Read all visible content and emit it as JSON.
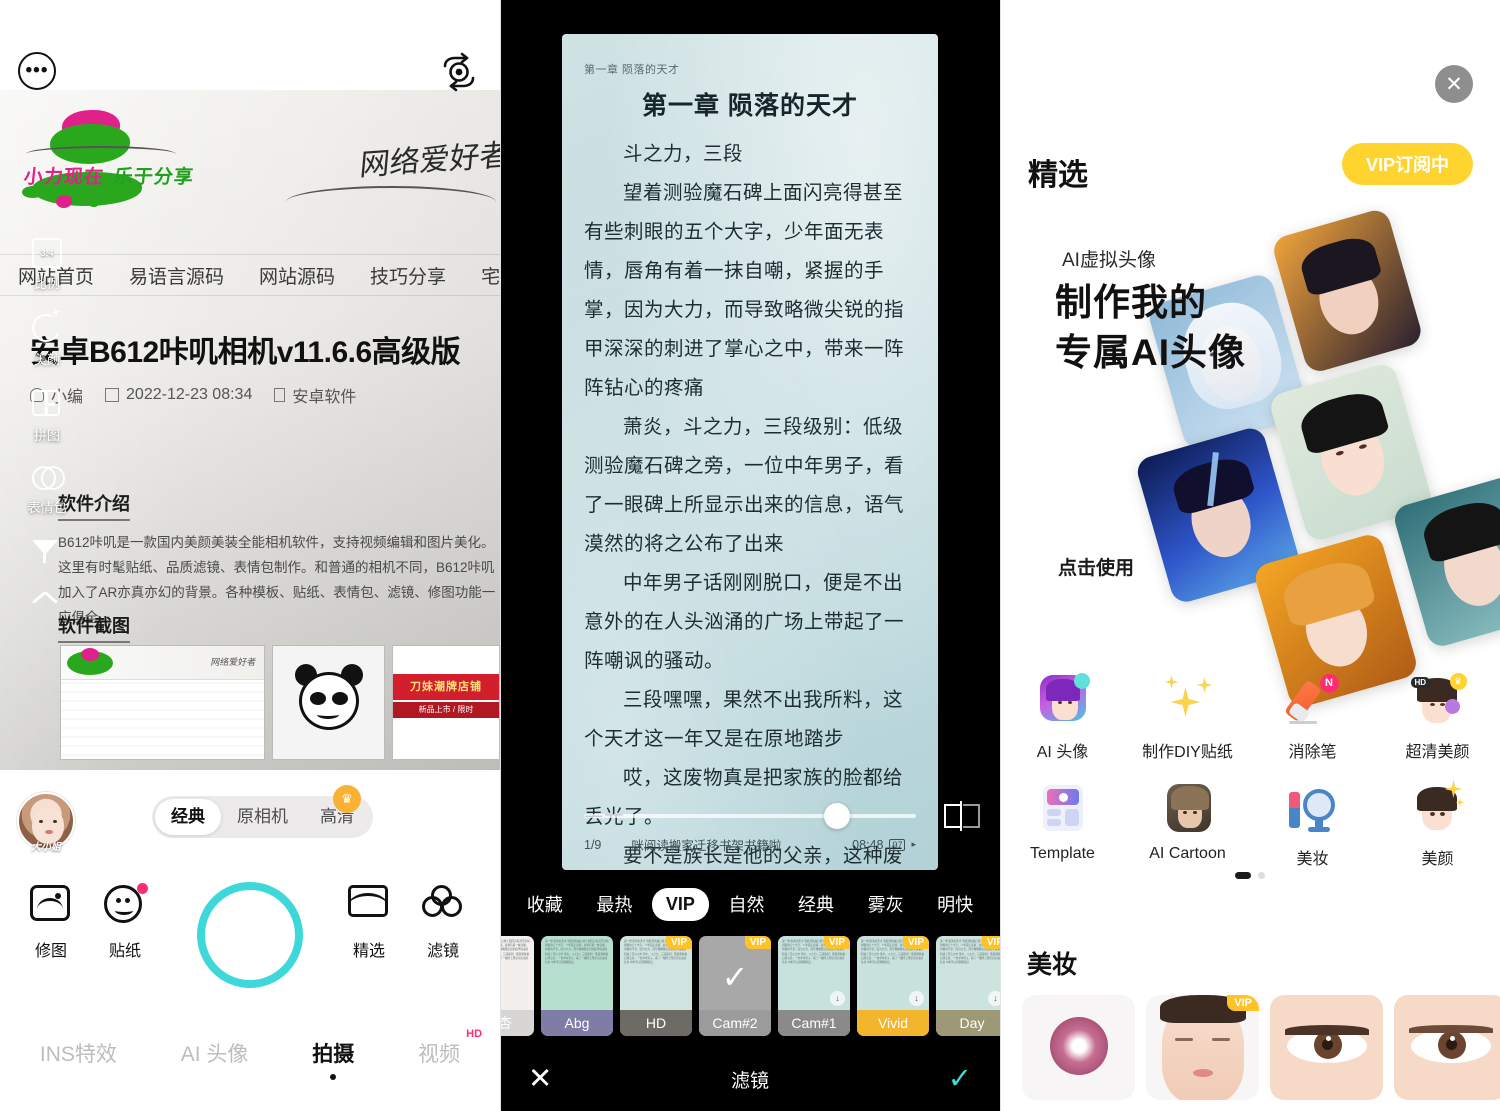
{
  "camera": {
    "topbar": {
      "more_icon": "more-dots-icon",
      "flip_icon": "camera-flip-icon"
    },
    "photo": {
      "logo_text_pink": "小力现在",
      "logo_text_green": "乐于分享",
      "handwriting": "网络爱好者",
      "nav_items": [
        "网站首页",
        "易语言源码",
        "网站源码",
        "技巧分享",
        "宅享"
      ],
      "article_title": "安卓B612咔叽相机v11.6.6高级版",
      "author": "小编",
      "date": "2022-12-23 08:34",
      "category": "安卓软件",
      "section_intro": "软件介绍",
      "section_shots": "软件截图",
      "body": "B612咔叽是一款国内美颜美装全能相机软件，支持视频编辑和图片美化。这里有时髦贴纸、品质滤镜、表情包制作。和普通的相机不同，B612咔叽加入了AR亦真亦幻的背景。各种模板、贴纸、表情包、滤镜、修图功能一应俱全。",
      "shop_banner": "刀妹潮牌店铺",
      "shop_sub": "新品上市 / 限时"
    },
    "tools": [
      {
        "label": "比例",
        "icon": "aspect-ratio-icon"
      },
      {
        "label": "美颜",
        "icon": "beauty-sparkle-icon"
      },
      {
        "label": "拼图",
        "icon": "collage-grid-icon"
      },
      {
        "label": "表情包",
        "icon": "sticker-circles-icon"
      },
      {
        "label": "",
        "icon": "filter-funnel-icon"
      },
      {
        "label": "",
        "icon": "chevron-up-icon"
      }
    ],
    "avatar_name": "大小姐",
    "modes": [
      {
        "label": "经典",
        "active": true
      },
      {
        "label": "原相机",
        "active": false
      },
      {
        "label": "高清",
        "active": false
      }
    ],
    "crown_icon": "crown-icon",
    "shutter": "shutter-button",
    "actions": [
      {
        "label": "修图",
        "icon": "photo-edit-icon"
      },
      {
        "label": "贴纸",
        "icon": "sticker-smiley-icon",
        "badge": true
      },
      {
        "label": "精选",
        "icon": "featured-shop-icon"
      },
      {
        "label": "滤镜",
        "icon": "filter-lens-icon"
      }
    ],
    "tabs": [
      {
        "label": "INS特效",
        "active": false
      },
      {
        "label": "AI 头像",
        "active": false
      },
      {
        "label": "拍摄",
        "active": true
      },
      {
        "label": "视频",
        "active": false,
        "sup": "HD"
      }
    ]
  },
  "reader": {
    "running_head": "第一章 陨落的天才",
    "chapter_title": "第一章 陨落的天才",
    "paragraphs": [
      "斗之力，三段",
      "望着测验魔石碑上面闪亮得甚至有些刺眼的五个大字，少年面无表情，唇角有着一抹自嘲，紧握的手掌，因为大力，而导致略微尖锐的指甲深深的刺进了掌心之中，带来一阵阵钻心的疼痛",
      "萧炎，斗之力，三段级别：低级测验魔石碑之旁，一位中年男子，看了一眼碑上所显示出来的信息，语气漠然的将之公布了出来",
      "中年男子话刚刚脱口，便是不出意外的在人头汹涌的广场上带起了一阵嘲讽的骚动。",
      "三段嘿嘿，果然不出我所料，这个天才这一年又是在原地踏步",
      "哎，这废物真是把家族的脸都给丢光了。",
      "要不是族长是他的父亲，这种废物，早就被驱赶出家族，任其自生自灭了，哪"
    ],
    "footer": {
      "page": "1/9",
      "notice": "咪阅读搬家迁移书架书籍啦",
      "time": "08:48",
      "battery": "97"
    },
    "split_icon": "split-compare-icon",
    "filter_tabs": [
      {
        "label": "收藏",
        "active": false
      },
      {
        "label": "最热",
        "active": false
      },
      {
        "label": "VIP",
        "active": true
      },
      {
        "label": "自然",
        "active": false
      },
      {
        "label": "经典",
        "active": false
      },
      {
        "label": "雾灰",
        "active": false
      },
      {
        "label": "明快",
        "active": false
      }
    ],
    "filters": [
      {
        "name": "浅杏",
        "cap_bg": "#d8d6d4",
        "tint": "#f2efec",
        "vip": false,
        "selected": false,
        "download": false
      },
      {
        "name": "Abg",
        "cap_bg": "#7f7ca8",
        "tint": "#b7dfd0",
        "vip": false,
        "selected": false,
        "download": false
      },
      {
        "name": "HD",
        "cap_bg": "#6e6b66",
        "tint": "#cfe4df",
        "vip": true,
        "selected": false,
        "download": false
      },
      {
        "name": "Cam#2",
        "cap_bg": "#9b9b9b",
        "tint": "#a8a8a8",
        "vip": true,
        "selected": true,
        "download": false
      },
      {
        "name": "Cam#1",
        "cap_bg": "#8a8a8a",
        "tint": "#c7e2dd",
        "vip": true,
        "selected": false,
        "download": true
      },
      {
        "name": "Vivid",
        "cap_bg": "#f2b52c",
        "tint": "#c9e2dd",
        "vip": true,
        "selected": false,
        "download": true
      },
      {
        "name": "Day",
        "cap_bg": "#9d9875",
        "tint": "#cde3de",
        "vip": true,
        "selected": false,
        "download": true
      }
    ],
    "bottom_bar": {
      "cancel_icon": "close-x-icon",
      "title": "滤镜",
      "confirm_icon": "check-icon"
    },
    "thumb_text": "第一章 陨落的天才 望着测验魔石碑上面闪亮得甚至有些刺眼的五个大字，少年面无表情，唇角有着一抹自嘲，紧握的手掌，因为大力，而导致略微尖锐的指甲深深的刺进了掌心之中 萧炎，斗之力，三段级别：低级测验魔石碑之旁，一位中年男子，看了一眼碑上所显示出来的信息 中年男子话刚刚脱口"
  },
  "featured": {
    "close_icon": "close-circle-icon",
    "title": "精选",
    "vip_button": "VIP订阅中",
    "banner": {
      "subtitle": "AI虚拟头像",
      "headline_line1": "制作我的",
      "headline_line2": "专属AI头像",
      "cta": "点击使用"
    },
    "grid": [
      {
        "label": "AI 头像",
        "icon": "ai-avatar-icon",
        "badge": ""
      },
      {
        "label": "制作DIY贴纸",
        "icon": "sparkles-icon",
        "badge": ""
      },
      {
        "label": "消除笔",
        "icon": "eraser-pen-icon",
        "badge": "N"
      },
      {
        "label": "超清美颜",
        "icon": "hd-beauty-icon",
        "badge": "HD"
      },
      {
        "label": "Template",
        "icon": "template-icon",
        "badge": ""
      },
      {
        "label": "AI Cartoon",
        "icon": "ai-cartoon-icon",
        "badge": ""
      },
      {
        "label": "美妆",
        "icon": "lipstick-mirror-icon",
        "badge": ""
      },
      {
        "label": "美颜",
        "icon": "beauty-face-icon",
        "badge": ""
      }
    ],
    "page_dots": {
      "active": 0,
      "count": 2
    },
    "section_makeup": "美妆",
    "makeup": [
      {
        "name": "contact-lens",
        "vip": false
      },
      {
        "name": "full-face-makeup",
        "vip": true
      },
      {
        "name": "eyeliner-left",
        "vip": false
      },
      {
        "name": "eyeliner-right",
        "vip": false
      }
    ]
  },
  "colors": {
    "accent_cyan": "#3fd8da",
    "vip_yellow": "#ffd42e",
    "badge_pink": "#ff2d6f",
    "book_bg": "#c6dde0"
  }
}
